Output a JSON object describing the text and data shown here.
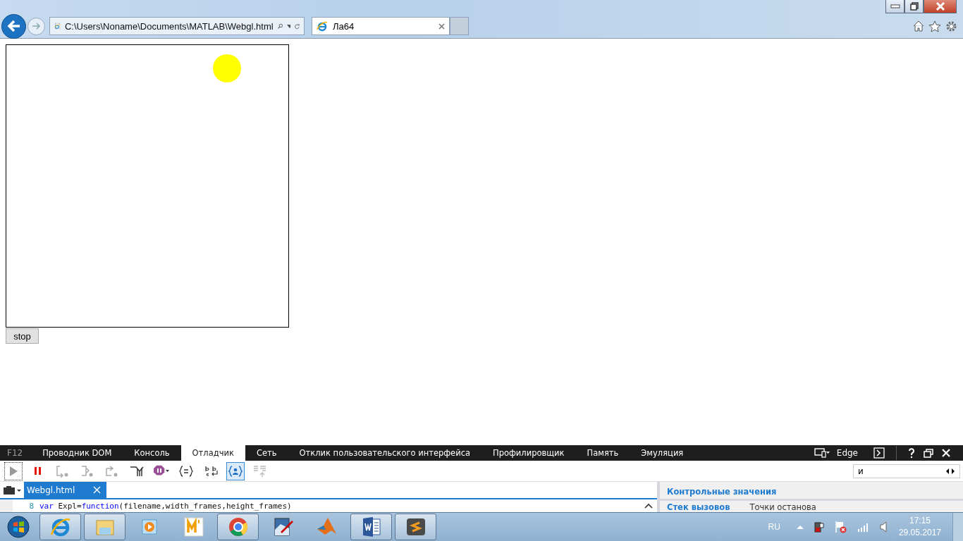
{
  "browser": {
    "address": "C:\\Users\\Noname\\Documents\\MATLAB\\Webgl.html",
    "tabs": [
      {
        "title": "Ла64",
        "selected": true
      }
    ]
  },
  "page": {
    "stop_button": "stop"
  },
  "devtools": {
    "f12": "F12",
    "tabs": [
      {
        "label": "Проводник DOM",
        "selected": false
      },
      {
        "label": "Консоль",
        "selected": false
      },
      {
        "label": "Отладчик",
        "selected": true
      },
      {
        "label": "Сеть",
        "selected": false
      },
      {
        "label": "Отклик пользовательского интерфейса",
        "selected": false
      },
      {
        "label": "Профилировщик",
        "selected": false
      },
      {
        "label": "Память",
        "selected": false
      },
      {
        "label": "Эмуляция",
        "selected": false
      }
    ],
    "mode": "Edge",
    "toolbar": [
      {
        "kind": "continue",
        "on": false
      },
      {
        "kind": "break",
        "on": false
      },
      {
        "kind": "step-into",
        "on": false
      },
      {
        "kind": "step-over",
        "on": false
      },
      {
        "kind": "step-out",
        "on": false
      },
      {
        "kind": "break-new-worker",
        "on": false
      },
      {
        "kind": "exceptions",
        "on": false
      },
      {
        "kind": "pretty-print",
        "on": false
      },
      {
        "kind": "word-wrap",
        "on": false
      },
      {
        "kind": "just-my-code",
        "on": true
      },
      {
        "kind": "source-maps",
        "on": false
      }
    ],
    "search": {
      "value": "и"
    },
    "file_tab": "Webgl.html",
    "code": [
      {
        "number": "8",
        "tokens": [
          {
            "kind": "keyword",
            "text": "var"
          },
          {
            "kind": "plain",
            "text": " Expl="
          },
          {
            "kind": "keyword",
            "text": "function"
          },
          {
            "kind": "plain",
            "text": "(filename,width_frames,height_frames)"
          }
        ]
      }
    ],
    "watch_title": "Контрольные значения",
    "panel_tabs": [
      {
        "label": "Стек вызовов",
        "selected": true
      },
      {
        "label": "Точки останова",
        "selected": false
      }
    ]
  },
  "taskbar": {
    "apps": [
      {
        "kind": "ie",
        "running": true
      },
      {
        "kind": "folder",
        "running": true
      },
      {
        "kind": "media",
        "running": false
      },
      {
        "kind": "m",
        "running": false
      },
      {
        "kind": "chrome",
        "running": true
      },
      {
        "kind": "paint",
        "running": false
      },
      {
        "kind": "matlab",
        "running": false
      },
      {
        "kind": "word",
        "running": true
      },
      {
        "kind": "sublime",
        "running": true
      }
    ],
    "language": "RU",
    "time": "17:15",
    "date": "29.05.2017"
  }
}
